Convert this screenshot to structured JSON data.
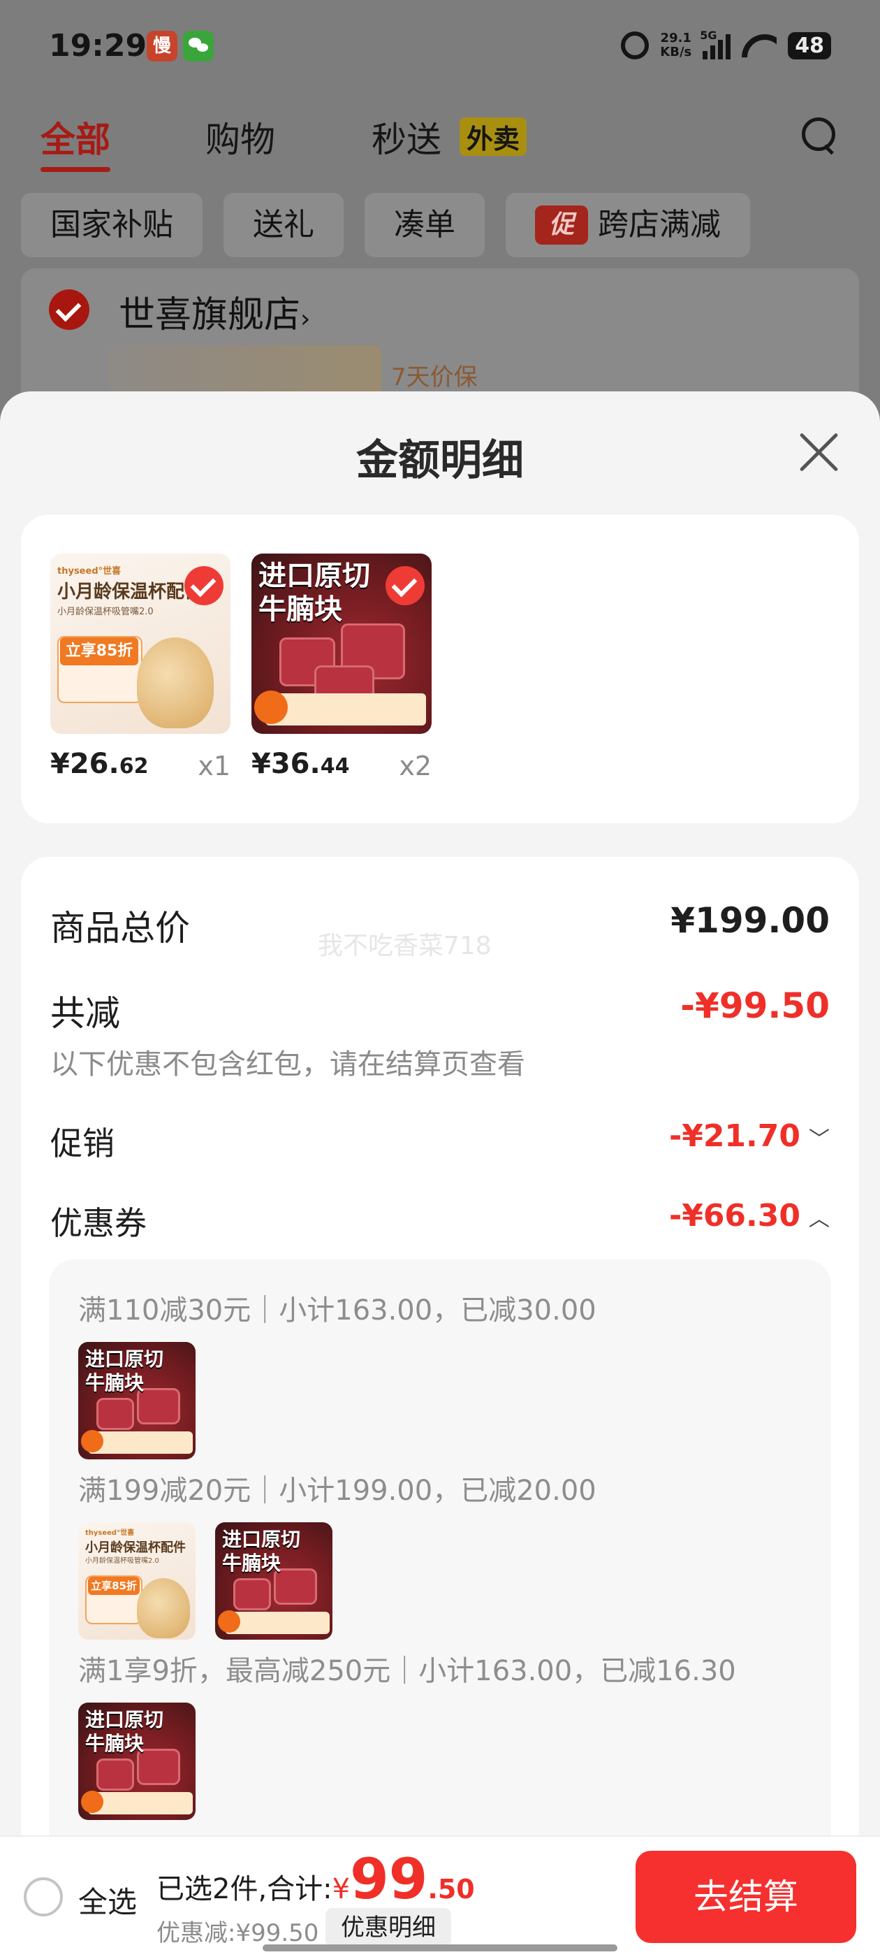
{
  "status_bar": {
    "time": "19:29",
    "app_icon_text": "慢",
    "net_speed_value": "29.1",
    "net_speed_unit": "KB/s",
    "network": "5G",
    "battery": "48"
  },
  "tabs": [
    {
      "label": "全部",
      "active": true
    },
    {
      "label": "购物",
      "active": false
    },
    {
      "label": "秒送",
      "active": false
    }
  ],
  "tab_badge": "外卖",
  "chips": [
    {
      "label": "国家补贴"
    },
    {
      "label": "送礼"
    },
    {
      "label": "凑单"
    },
    {
      "label": "跨店满减",
      "mark": "促"
    }
  ],
  "store": {
    "name": "世喜旗舰店",
    "chevron": "›",
    "tag": "7天价保"
  },
  "sheet": {
    "title": "金额明细"
  },
  "products": [
    {
      "price_int": "¥26.",
      "price_dec": "62",
      "qty": "x1",
      "image": "bottle",
      "image_text": {
        "brand": "thyseed°世喜",
        "headline": "小月龄保温杯配件",
        "sub": "小月龄保温杯吸管嘴2.0",
        "promo": "立享85折"
      }
    },
    {
      "price_int": "¥36.",
      "price_dec": "44",
      "qty": "x2",
      "image": "beef",
      "image_text": {
        "line1": "进口原切",
        "line2": "牛腩块"
      }
    }
  ],
  "details": {
    "watermark": "我不吃香菜718",
    "total_label": "商品总价",
    "total_value": "¥199.00",
    "reduce_label": "共减",
    "reduce_value": "-¥99.50",
    "reduce_note": "以下优惠不包含红包，请在结算页查看",
    "promo_label": "促销",
    "promo_value": "-¥21.70",
    "promo_caret": "﹀",
    "coupon_label": "优惠券",
    "coupon_value": "-¥66.30",
    "coupon_caret": "︿"
  },
  "coupon_lines": [
    "满110减30元｜小计163.00，已减30.00",
    "满199减20元｜小计199.00，已减20.00",
    "满1享9折，最高减250元｜小计163.00，已减16.30"
  ],
  "bottom_bar": {
    "select_all": "全选",
    "selected_text": "已选2件,合计:",
    "yen": "¥",
    "total_int": "99",
    "total_dec": ".50",
    "discount_text": "优惠减:¥99.50",
    "detail_button": "优惠明细",
    "checkout_button": "去结算"
  },
  "colors": {
    "accent": "#ef2f28",
    "checkout": "#f5302f",
    "tab_active": "#a61b14"
  }
}
